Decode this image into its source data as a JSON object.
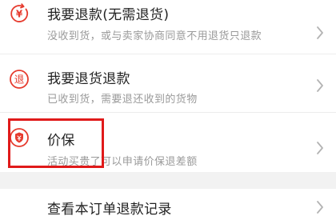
{
  "options": [
    {
      "icon": "yen-return-icon",
      "title": "我要退款(无需退货)",
      "subtitle": "没收到货，或与卖家协商同意不用退货只退款"
    },
    {
      "icon": "return-goods-icon",
      "title": "我要退货退款",
      "subtitle": "已收到货，需要退还收到的货物"
    },
    {
      "icon": "price-protect-shield-icon",
      "title": "价保",
      "subtitle": "活动买贵了可以申请价保退差额"
    }
  ],
  "records": {
    "title": "查看本订单退款记录"
  },
  "icon_glyphs": {
    "yen": "¥",
    "return": "退"
  },
  "colors": {
    "accent": "#e63b2e",
    "highlight": "#e01a1a",
    "title": "#222222",
    "subtitle": "#9a9a9a",
    "background": "#f2f2f2"
  }
}
